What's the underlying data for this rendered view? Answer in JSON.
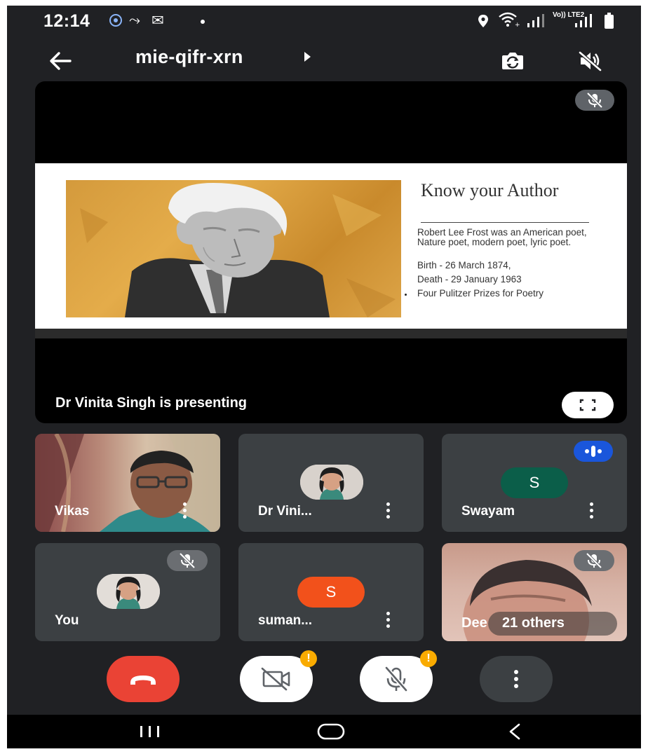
{
  "status_bar": {
    "time": "12:14",
    "network_label": "Vo)) LTE2"
  },
  "header": {
    "meeting_code": "mie-qifr-xrn"
  },
  "presentation": {
    "presenter_label": "Dr Vinita Singh is presenting",
    "slide": {
      "heading": "Know your Author",
      "description": "Robert Lee Frost was an American poet, Nature poet, modern poet, lyric poet.",
      "birth": "Birth - 26 March 1874,",
      "death": "Death - 29 January 1963",
      "prizes": "Four Pulitzer Prizes for Poetry"
    }
  },
  "participants": [
    {
      "name": "Vikas"
    },
    {
      "name": "Dr Vini..."
    },
    {
      "name": "Swayam",
      "initial": "S",
      "avatar_color": "#0b5e49"
    },
    {
      "name": "You"
    },
    {
      "name": "suman...",
      "initial": "S",
      "avatar_color": "#f2511b"
    },
    {
      "name": "Dee"
    }
  ],
  "others_label": "21 others",
  "colors": {
    "background": "#202124",
    "end_call": "#ea4335",
    "speaking_badge": "#1a56db",
    "warning": "#f9ab00"
  },
  "controls": {
    "camera_warning": "!",
    "mic_warning": "!"
  }
}
